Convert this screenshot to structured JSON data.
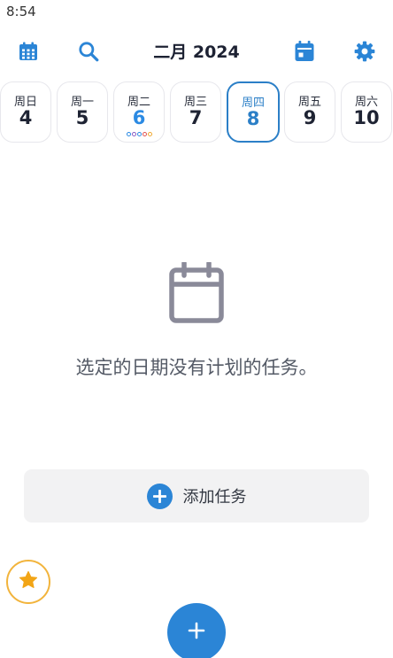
{
  "status_bar": {
    "time": "8:54"
  },
  "header": {
    "month_title": "二月 2024",
    "icons": [
      "calendar-grid-icon",
      "search-icon",
      "calendar-today-icon",
      "gear-icon"
    ]
  },
  "week": [
    {
      "dow": "周日",
      "num": "4"
    },
    {
      "dow": "周一",
      "num": "5"
    },
    {
      "dow": "周二",
      "num": "6",
      "today": true,
      "dots": [
        "#2b8ae3",
        "#8a5cc4",
        "#2b8ae3",
        "#e05353",
        "#f0a830"
      ]
    },
    {
      "dow": "周三",
      "num": "7"
    },
    {
      "dow": "周四",
      "num": "8",
      "selected": true
    },
    {
      "dow": "周五",
      "num": "9"
    },
    {
      "dow": "周六",
      "num": "10"
    }
  ],
  "empty_state": {
    "icon": "calendar-outline-icon",
    "message": "选定的日期没有计划的任务。"
  },
  "add_task": {
    "label": "添加任务",
    "icon": "plus-circle-icon"
  },
  "favorites_button": {
    "icon": "star-icon"
  },
  "fab": {
    "icon": "plus-icon"
  },
  "colors": {
    "accent": "#2b85d6",
    "selected_border": "#2b7fc7",
    "star": "#f2a516",
    "empty_icon": "#8a8a99"
  }
}
